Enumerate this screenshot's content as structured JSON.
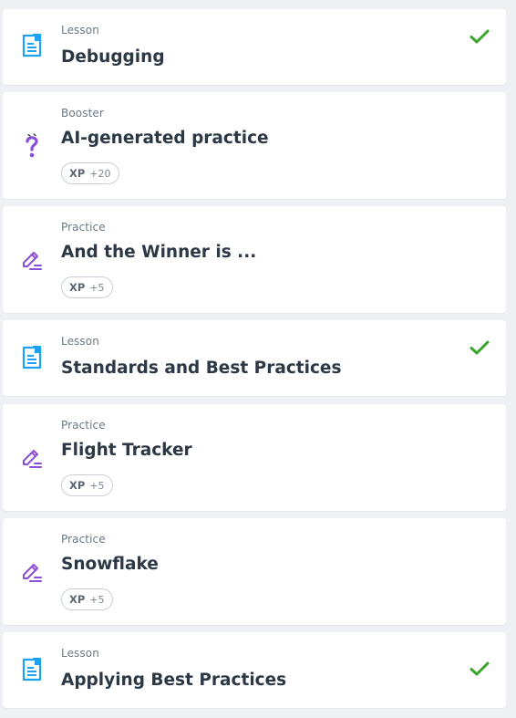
{
  "items": [
    {
      "kind": "Lesson",
      "title": "Debugging",
      "icon": "lesson-icon",
      "completed": true
    },
    {
      "kind": "Booster",
      "title": "AI-generated practice",
      "icon": "question-icon",
      "xp_label": "XP",
      "xp_value": "+20"
    },
    {
      "kind": "Practice",
      "title": "And the Winner is ...",
      "icon": "pencil-icon",
      "xp_label": "XP",
      "xp_value": "+5"
    },
    {
      "kind": "Lesson",
      "title": "Standards and Best Practices",
      "icon": "lesson-icon",
      "completed": true
    },
    {
      "kind": "Practice",
      "title": "Flight Tracker",
      "icon": "pencil-icon",
      "xp_label": "XP",
      "xp_value": "+5"
    },
    {
      "kind": "Practice",
      "title": "Snowflake",
      "icon": "pencil-icon",
      "xp_label": "XP",
      "xp_value": "+5"
    },
    {
      "kind": "Lesson",
      "title": "Applying Best Practices",
      "icon": "lesson-icon",
      "completed": true
    }
  ],
  "colors": {
    "lesson_icon": "#1da1f2",
    "practice_icon": "#8a4fd6",
    "check": "#3aa52b"
  }
}
